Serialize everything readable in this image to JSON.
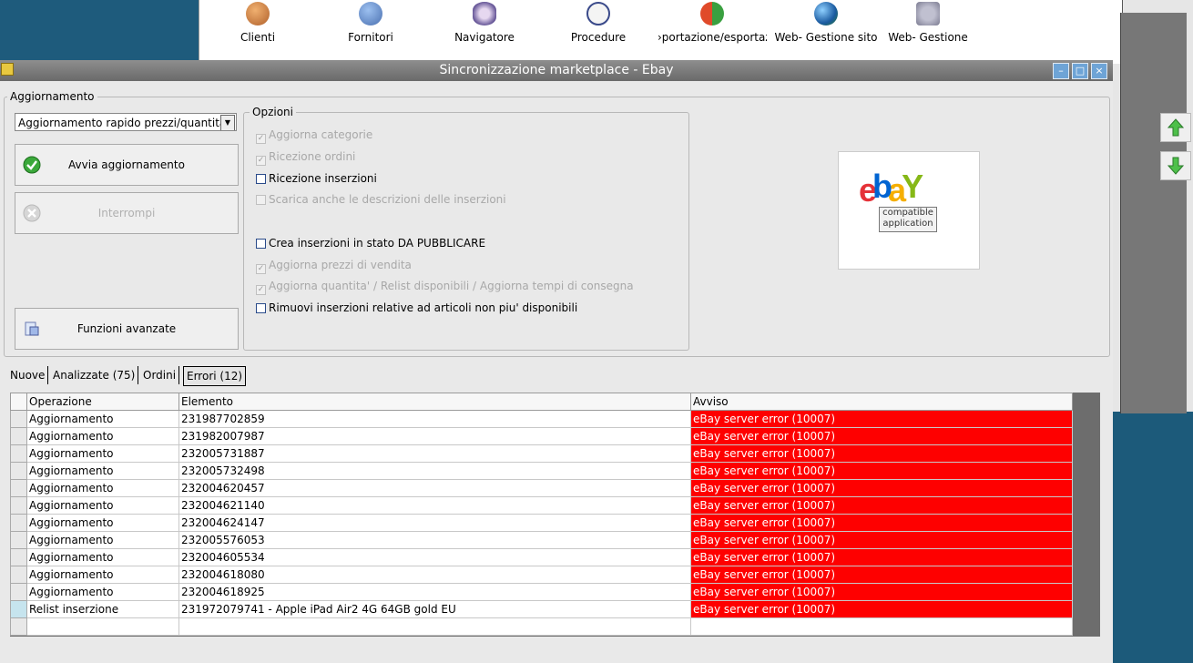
{
  "toolbar": {
    "items": [
      {
        "label": "Clienti",
        "icon": "clients-icon"
      },
      {
        "label": "Fornitori",
        "icon": "suppliers-icon"
      },
      {
        "label": "Navigatore",
        "icon": "navigator-icon"
      },
      {
        "label": "Procedure",
        "icon": "procedures-icon"
      },
      {
        "label": "›portazione/esportazic",
        "icon": "import-export-icon"
      },
      {
        "label": "Web- Gestione sito",
        "icon": "globe-icon"
      },
      {
        "label": "Web- Gestione",
        "icon": "cart-icon"
      }
    ]
  },
  "window": {
    "title": "Sincronizzazione marketplace - Ebay"
  },
  "aggiornamento": {
    "legend": "Aggiornamento",
    "combo_value": "Aggiornamento rapido prezzi/quantita'",
    "start_label": "Avvia aggiornamento",
    "stop_label": "Interrompi",
    "advanced_label": "Funzioni avanzate"
  },
  "opzioni": {
    "legend": "Opzioni",
    "items": [
      {
        "label": "Aggiorna categorie",
        "checked": true,
        "enabled": false
      },
      {
        "label": "Ricezione ordini",
        "checked": true,
        "enabled": false
      },
      {
        "label": "Ricezione inserzioni",
        "checked": false,
        "enabled": true
      },
      {
        "label": "Scarica anche le descrizioni delle inserzioni",
        "checked": false,
        "enabled": false
      },
      {
        "label": "Crea inserzioni in stato DA PUBBLICARE",
        "checked": false,
        "enabled": true
      },
      {
        "label": "Aggiorna prezzi di vendita",
        "checked": true,
        "enabled": false
      },
      {
        "label": "Aggiorna quantita' / Relist disponibili / Aggiorna tempi di consegna",
        "checked": true,
        "enabled": false
      },
      {
        "label": "Rimuovi inserzioni relative ad articoli non piu' disponibili",
        "checked": false,
        "enabled": true
      }
    ]
  },
  "logo": {
    "line1": "compatible",
    "line2": "application"
  },
  "tabs": [
    {
      "label": "Nuove"
    },
    {
      "label": "Analizzate (75)"
    },
    {
      "label": "Ordini"
    },
    {
      "label": "Errori (12)"
    }
  ],
  "table": {
    "columns": [
      "Operazione",
      "Elemento",
      "Avviso"
    ],
    "rows": [
      [
        "Aggiornamento",
        "231987702859",
        "eBay server error (10007)"
      ],
      [
        "Aggiornamento",
        "231982007987",
        "eBay server error (10007)"
      ],
      [
        "Aggiornamento",
        "232005731887",
        "eBay server error (10007)"
      ],
      [
        "Aggiornamento",
        "232005732498",
        "eBay server error (10007)"
      ],
      [
        "Aggiornamento",
        "232004620457",
        "eBay server error (10007)"
      ],
      [
        "Aggiornamento",
        "232004621140",
        "eBay server error (10007)"
      ],
      [
        "Aggiornamento",
        "232004624147",
        "eBay server error (10007)"
      ],
      [
        "Aggiornamento",
        "232005576053",
        "eBay server error (10007)"
      ],
      [
        "Aggiornamento",
        "232004605534",
        "eBay server error (10007)"
      ],
      [
        "Aggiornamento",
        "232004618080",
        "eBay server error (10007)"
      ],
      [
        "Aggiornamento",
        "232004618925",
        "eBay server error (10007)"
      ],
      [
        "Relist inserzione",
        "231972079741 - Apple iPad Air2 4G 64GB gold EU",
        "eBay server error (10007)"
      ]
    ]
  },
  "colors": {
    "error_bg": "#fe0000",
    "title_bg": "#7c7c7c",
    "accent": "#6ea4d6"
  }
}
